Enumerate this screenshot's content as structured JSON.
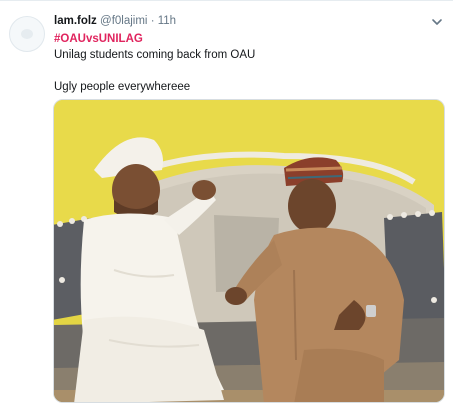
{
  "tweet": {
    "display_name": "lam.folz",
    "handle": "@f0lajimi",
    "separator": "·",
    "timestamp": "11h",
    "hashtag": "#OAUvsUNILAG",
    "text_line1": "Unilag students coming back from OAU",
    "text_line2": "Ugly people everywhereee"
  },
  "icons": {
    "avatar": "default-avatar",
    "menu": "chevron-down-icon"
  },
  "colors": {
    "name": "#14171a",
    "secondary": "#657786",
    "hashtag": "#e0245e",
    "photo_wall": "#e3d544"
  }
}
